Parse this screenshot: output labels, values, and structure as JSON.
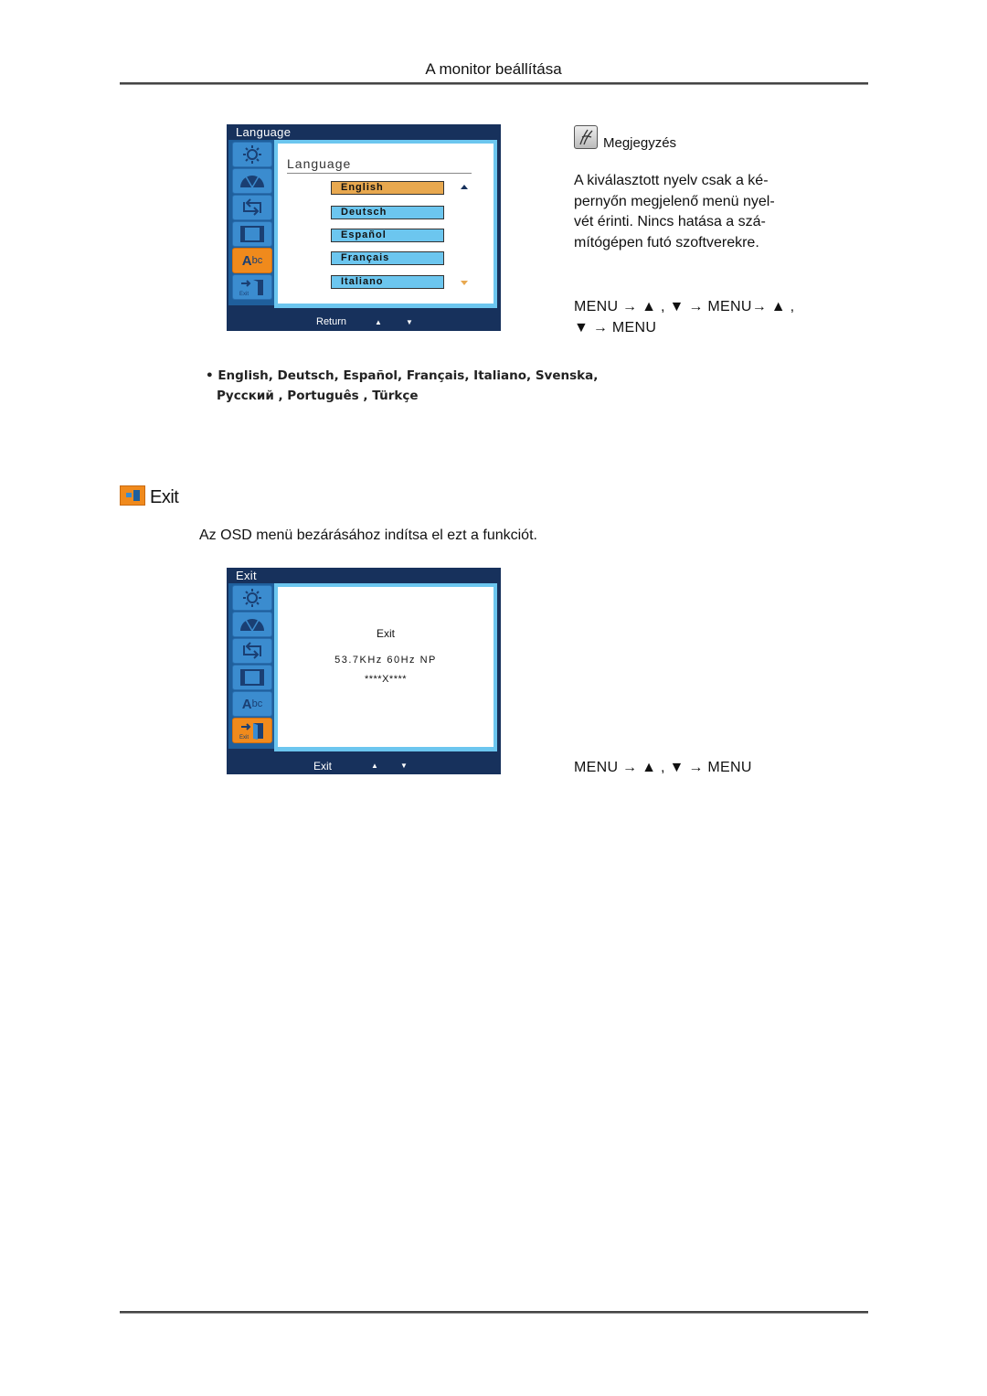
{
  "header": {
    "title": "A monitor beállítása"
  },
  "language_osd": {
    "title": "Language",
    "heading": "Language",
    "side_icons": [
      "brightness-icon",
      "color-icon",
      "image-setup-icon",
      "osd-icon",
      "language-icon",
      "exit-icon"
    ],
    "active_icon": 4,
    "options": [
      "English",
      "Deutsch",
      "Español",
      "Français",
      "Italiano"
    ],
    "selected": "English",
    "footer": {
      "label": "Return",
      "up": "▲",
      "down": "▼"
    }
  },
  "note": {
    "title": "Megjegyzés",
    "text": "A kiválasztott nyelv csak a képernyőn megjelenő menü nyelvét érinti. Nincs hatása a számítógépen futó szoftverekre.",
    "text_lines": [
      "A kiválasztott nyelv csak a ké-",
      "pernyőn megjelenő menü nyel-",
      "vét érinti. Nincs hatása a szá-",
      "mítógépen futó szoftverekre."
    ]
  },
  "language_sequence": [
    "MENU → ▲ , ▼ → MENU→ ▲ ,",
    "▼ → MENU"
  ],
  "language_list": [
    "• English, Deutsch, Español, Français,  Italiano, Svenska,",
    "Русский , Português , Türkçe"
  ],
  "exit_section": {
    "title": "Exit",
    "description": "Az OSD menü bezárásához indítsa el ezt a funkciót.",
    "sequence": "MENU → ▲ , ▼ → MENU"
  },
  "exit_osd": {
    "title": "Exit",
    "heading": "Exit",
    "frequency": "53.7KHz 60Hz NP",
    "resolution": "****X****",
    "active_icon": 5,
    "footer": {
      "label": "Exit",
      "up": "▲",
      "down": "▼"
    }
  }
}
